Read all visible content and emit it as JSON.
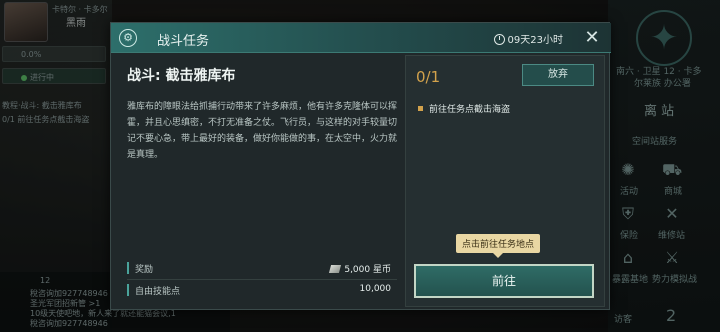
{
  "background": {
    "player_name": "黑雨",
    "player_tag": "卡特尔 · 卡多尔",
    "percent": "0.0%",
    "status_label": "进行中",
    "mission_hint_1": "教程·战斗: 截击雅库布",
    "mission_hint_2": "0/1 前往任务点截击海盗",
    "chat_count": "12",
    "chat_lines": [
      "稅咨询加927748946",
      "圣光军团招新管 >1",
      "10级天使吧地，新人来了就还能猫会议,1",
      "稅咨询加927748946"
    ],
    "location_line1": "南六 · 卫星 12 · 卡多",
    "location_line2": "尔莱族 办公署",
    "leave_station": "离 站",
    "station_services": "空间站服务",
    "menu": [
      {
        "label": "活动",
        "icon": "party-icon"
      },
      {
        "label": "商城",
        "icon": "cart-icon"
      },
      {
        "label": "保险",
        "icon": "shield-icon"
      },
      {
        "label": "维修站",
        "icon": "wrench-icon"
      },
      {
        "label": "暴露基地",
        "icon": "base-icon"
      },
      {
        "label": "势力模拟战",
        "icon": "swords-icon"
      }
    ],
    "visitor_label": "访客",
    "visitor_count": "2"
  },
  "dialog": {
    "title": "战斗任务",
    "timer": "09天23小时",
    "mission_name": "战斗: 截击雅库布",
    "description": "雅库布的障眼法给抓捕行动带来了许多麻烦，他有许多克隆体可以挥霍，并且心思缜密，不打无准备之仗。飞行员，与这样的对手较量切记不要心急，带上最好的装备，做好你能做的事，在太空中，火力就是真理。",
    "reward_label": "奖励",
    "reward_value": "5,000",
    "reward_currency": "星币",
    "skill_label": "自由技能点",
    "skill_value": "10,000",
    "progress": "0/1",
    "abandon_label": "放弃",
    "objective": "前往任务点截击海盗",
    "tooltip": "点击前往任务地点",
    "go_label": "前往"
  }
}
